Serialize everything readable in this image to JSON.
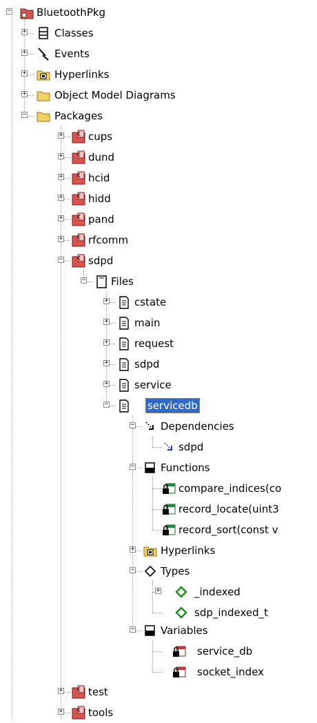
{
  "tree": {
    "root": "BluetoothPkg",
    "classes": "Classes",
    "events": "Events",
    "hyperlinks": "Hyperlinks",
    "object_model_diagrams": "Object Model Diagrams",
    "packages": "Packages",
    "pkgs": [
      "cups",
      "dund",
      "hcid",
      "hidd",
      "pand",
      "rfcomm",
      "sdpd"
    ],
    "files": "Files",
    "file_items": [
      "cstate",
      "main",
      "request",
      "sdpd",
      "service",
      "servicedb"
    ],
    "dependencies": "Dependencies",
    "dependency_items": [
      "sdpd"
    ],
    "functions": "Functions",
    "function_items": [
      "compare_indices(co",
      "record_locate(uint3",
      "record_sort(const v"
    ],
    "hyperlinks2": "Hyperlinks",
    "types": "Types",
    "type_items": [
      "_indexed",
      "sdp_indexed_t"
    ],
    "variables": "Variables",
    "variable_items": [
      "service_db",
      "socket_index"
    ],
    "bottom_pkgs": [
      "test",
      "tools"
    ]
  },
  "colors": {
    "selection": "#316ac5",
    "package": "#c0393b",
    "folder": "#e8c84a",
    "type": "#1a8a1a"
  }
}
